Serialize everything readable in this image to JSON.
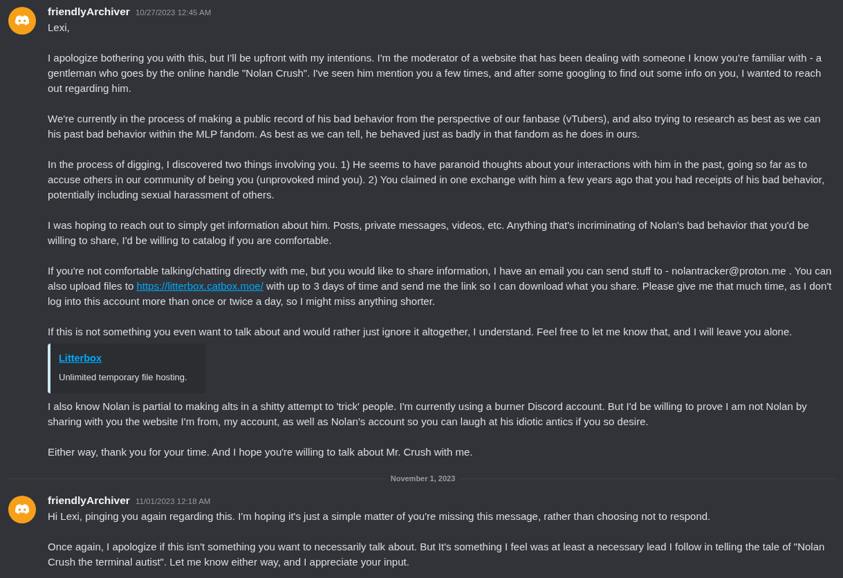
{
  "messages": [
    {
      "author": "friendlyArchiver",
      "timestamp": "10/27/2023 12:45 AM",
      "blocks": [
        {
          "kind": "text",
          "segments": [
            {
              "kind": "text",
              "text": "Lexi,"
            }
          ]
        },
        {
          "kind": "text",
          "segments": [
            {
              "kind": "text",
              "text": "I apologize bothering you with this, but I'll be upfront with my intentions. I'm the moderator of a website that has been dealing with someone I know you're familiar with - a gentleman who goes by the online handle \"Nolan Crush\". I've seen him mention you a few times, and after some googling to find out some info on you, I wanted to reach out regarding him."
            }
          ]
        },
        {
          "kind": "text",
          "segments": [
            {
              "kind": "text",
              "text": "We're currently in the process of making a public record of his bad behavior from the perspective of our fanbase (vTubers), and also trying to research as best as we can his past bad behavior within the MLP fandom. As best as we can tell, he behaved just as badly in that fandom as he does in ours."
            }
          ]
        },
        {
          "kind": "text",
          "segments": [
            {
              "kind": "text",
              "text": "In the process of digging, I discovered two things involving you. 1) He seems to have paranoid thoughts about your interactions with him in the past, going so far as to accuse others in our community of being you (unprovoked mind you). 2) You claimed in one exchange with him a few years ago that you had receipts of his bad behavior, potentially including sexual harassment of others."
            }
          ]
        },
        {
          "kind": "text",
          "segments": [
            {
              "kind": "text",
              "text": "I was hoping to reach out to simply get information about him. Posts, private messages, videos, etc. Anything that's incriminating of Nolan's bad behavior that you'd be willing to share, I'd be willing to catalog if you are comfortable."
            }
          ]
        },
        {
          "kind": "text",
          "segments": [
            {
              "kind": "text",
              "text": "If you're not comfortable talking/chatting directly with me, but you would like to share information, I have an email you can send stuff to - nolantracker@proton.me . You can also upload files to "
            },
            {
              "kind": "link",
              "text": "https://litterbox.catbox.moe/"
            },
            {
              "kind": "text",
              "text": " with up to 3 days of time and send me the link so I can download what you share. Please give me that much time, as I don't log into this account more than once or twice a day, so I might miss anything shorter."
            }
          ]
        },
        {
          "kind": "text",
          "segments": [
            {
              "kind": "text",
              "text": "If this is not something you even want to talk about and would rather just ignore it altogether, I understand. Feel free to let me know that, and I will leave you alone."
            }
          ]
        },
        {
          "kind": "embed",
          "title": "Litterbox",
          "description": "Unlimited temporary file hosting."
        },
        {
          "kind": "text",
          "segments": [
            {
              "kind": "text",
              "text": "I also know Nolan is partial to making alts in a shitty attempt to 'trick' people. I'm currently using a burner Discord account. But I'd be willing to prove I am not Nolan by sharing with you the website I'm from, my account, as well as Nolan's account so you can laugh at his idiotic antics if you so desire."
            }
          ]
        },
        {
          "kind": "text",
          "segments": [
            {
              "kind": "text",
              "text": "Either way, thank you for your time. And I hope you're willing to talk about Mr. Crush with me."
            }
          ]
        }
      ]
    },
    {
      "date_divider": "November 1, 2023",
      "author": "friendlyArchiver",
      "timestamp": "11/01/2023 12:18 AM",
      "blocks": [
        {
          "kind": "text",
          "segments": [
            {
              "kind": "text",
              "text": "Hi Lexi, pinging you again regarding this. I'm hoping it's just a simple matter of you're missing this message, rather than choosing not to respond."
            }
          ]
        },
        {
          "kind": "text",
          "segments": [
            {
              "kind": "text",
              "text": "Once again, I apologize if this isn't something you want to necessarily talk about. But It's something I feel was at least a necessary lead I follow in telling the tale of \"Nolan Crush the terminal autist\". Let me know either way, and I appreciate your input."
            }
          ]
        }
      ]
    }
  ]
}
